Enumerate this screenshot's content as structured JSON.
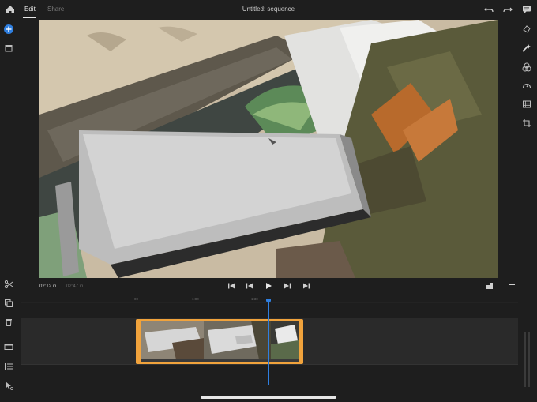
{
  "header": {
    "tabs": [
      {
        "label": "Edit",
        "active": true
      },
      {
        "label": "Share",
        "active": false
      }
    ],
    "title": "Untitled: sequence"
  },
  "left_toolbar": [
    "home-icon",
    "add-icon",
    "archive-icon",
    "split-icon",
    "duplicate-icon",
    "delete-icon",
    "media-icon",
    "list-icon",
    "pointer-icon"
  ],
  "right_toolbar": [
    "comment-icon",
    "transform-icon",
    "color-icon",
    "layers-icon",
    "speed-icon",
    "grid-icon",
    "crop-rotate-icon"
  ],
  "playback": {
    "current_time": "02:12 in",
    "total_time": "02:47 in"
  },
  "timeline": {
    "ruler_labels": [
      "00",
      "1:00",
      "1:30"
    ]
  },
  "colors": {
    "accent": "#2f7fe0",
    "clip": "#f1a33c",
    "background": "#1e1e1e"
  }
}
